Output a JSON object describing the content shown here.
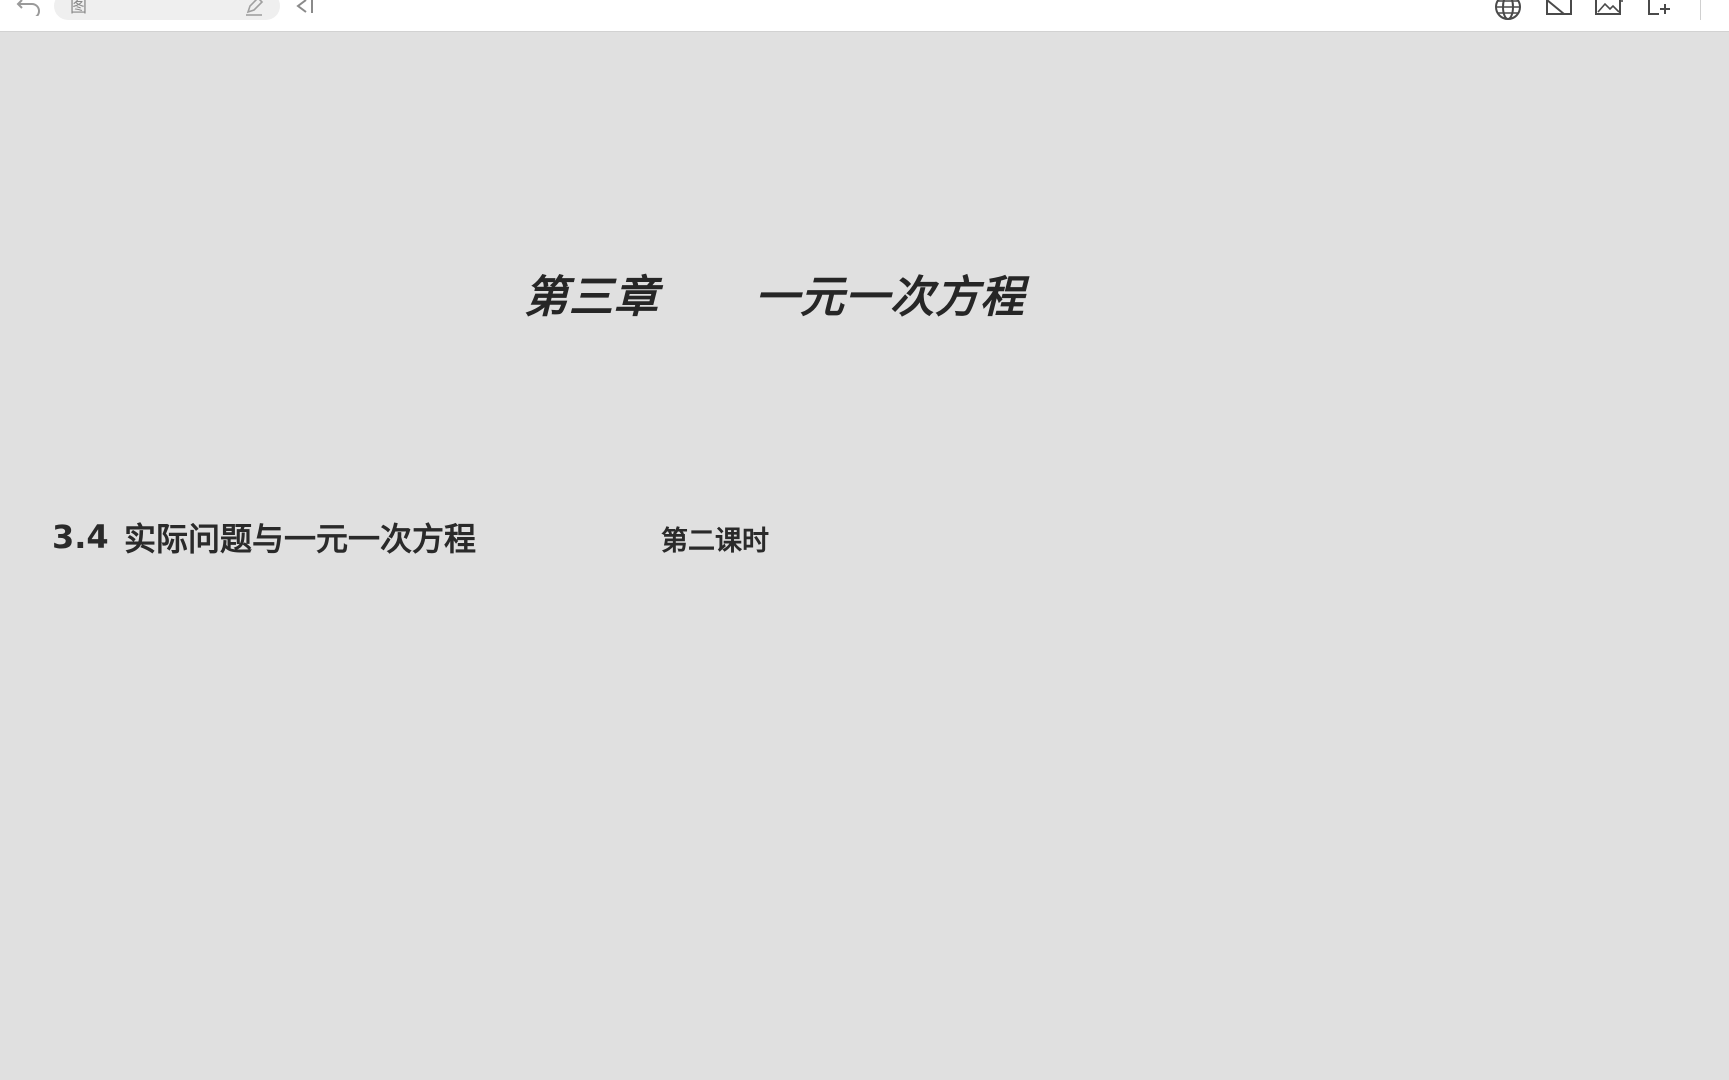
{
  "toolbar": {
    "search_text": "图",
    "icons": [
      "undo-icon",
      "edit-icon",
      "back-icon",
      "globe-icon",
      "crop-icon",
      "image-add-icon",
      "frame-add-icon"
    ]
  },
  "slide": {
    "chapter_label": "第三章",
    "chapter_name": "一元一次方程",
    "section_number": "3.4",
    "section_title": "实际问题与一元一次方程",
    "lesson": "第二课时"
  },
  "colors": {
    "canvas": "#e0e0e0",
    "toolbar": "#ffffff",
    "text": "#262626",
    "icon": "#4a4a4a"
  }
}
